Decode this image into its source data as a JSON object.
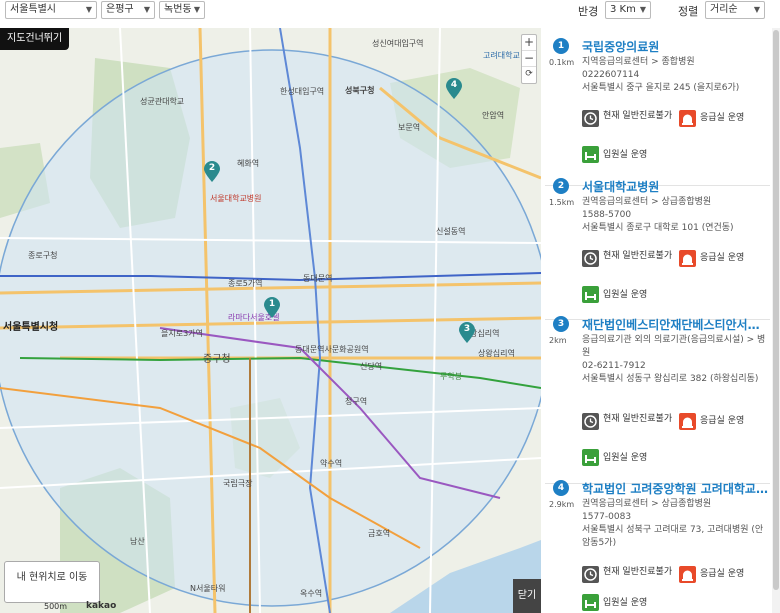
{
  "filters": {
    "sido": "서울특별시",
    "gu": "은평구",
    "dong": "녹번동",
    "radius_label": "반경",
    "radius": "3 Km",
    "sort_label": "정렬",
    "sort": "거리순"
  },
  "map": {
    "skip_button": "지도건너뛰기",
    "zoom_in": "+",
    "zoom_out": "−",
    "reset": "⟳",
    "current_location_button": "내 현위치로 이동",
    "close_button": "닫기",
    "scale": "500m",
    "provider": "kakao",
    "pins": [
      "1",
      "2",
      "3",
      "4"
    ],
    "labels": [
      "서울특별시청",
      "종로구청",
      "성북구청",
      "서울대학교병원",
      "혜화역",
      "동대문역",
      "종로5가역",
      "을지로3가역",
      "중구청",
      "동대문역사문화공원역",
      "신당역",
      "청구역",
      "약수역",
      "한성대입구역",
      "보문역",
      "안암역",
      "신설동역",
      "고려대학교",
      "성신여대입구역",
      "라마다서울호텔",
      "무학봉",
      "남산",
      "N서울타워",
      "금호역",
      "옥수역",
      "성균관대학교",
      "국립극장",
      "왕십리역",
      "상왕십리역"
    ]
  },
  "hospitals": [
    {
      "num": "1",
      "distance": "0.1km",
      "name": "국립중앙의료원",
      "type": "지역응급의료센터 > 종합병원",
      "phone": "0222607114",
      "address": "서울특별시 중구 을지로 245 (을지로6가)",
      "status_hours": "현재 일반진료불가",
      "status_er": "응급실 운영",
      "status_ward": "입원실 운영"
    },
    {
      "num": "2",
      "distance": "1.5km",
      "name": "서울대학교병원",
      "type": "권역응급의료센터 > 상급종합병원",
      "phone": "1588-5700",
      "address": "서울특별시 종로구 대학로 101 (연건동)",
      "status_hours": "현재 일반진료불가",
      "status_er": "응급실 운영",
      "status_ward": "입원실 운영"
    },
    {
      "num": "3",
      "distance": "2km",
      "name": "재단법인베스티안재단베스티안서울병원",
      "type": "응급의료기관 외의 의료기관(응급의료시설) > 병원",
      "phone": "02-6211-7912",
      "address": "서울특별시 성동구 왕십리로 382 (하왕십리동)",
      "status_hours": "현재 일반진료불가",
      "status_er": "응급실 운영",
      "status_ward": "입원실 운영"
    },
    {
      "num": "4",
      "distance": "2.9km",
      "name": "학교법인 고려중앙학원 고려대학교의과대학부속병원",
      "type": "권역응급의료센터 > 상급종합병원",
      "phone": "1577-0083",
      "address": "서울특별시 성북구 고려대로 73, 고려대병원 (안암동5가)",
      "status_hours": "현재 일반진료불가",
      "status_er": "응급실 운영",
      "status_ward": "입원실 운영"
    }
  ],
  "colors": {
    "accent": "#1e7fc4",
    "pin": "#2a8a8e",
    "er_icon": "#e84a2a",
    "ward_icon": "#3aa03a",
    "clock_icon": "#555555"
  }
}
